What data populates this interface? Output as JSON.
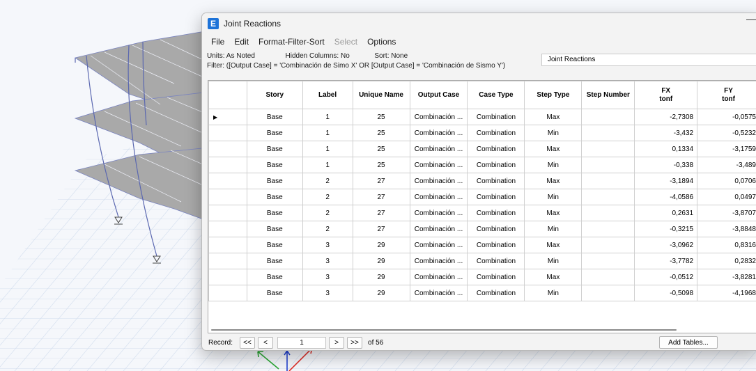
{
  "window": {
    "title": "Joint Reactions",
    "app_icon_letter": "E",
    "minimize_symbol": "—"
  },
  "menu": [
    "File",
    "Edit",
    "Format-Filter-Sort",
    "Select",
    "Options"
  ],
  "menu_disabled": [
    "Select"
  ],
  "info": {
    "units_label": "Units:",
    "units_value": "As Noted",
    "hidden_label": "Hidden Columns:",
    "hidden_value": "No",
    "sort_label": "Sort:",
    "sort_value": "None",
    "filter_label": "Filter:",
    "filter_value": "([Output Case] = 'Combinación de Simo X' OR [Output Case] = 'Combinación de Sismo Y')",
    "table_title": "Joint Reactions"
  },
  "columns": [
    {
      "name": "",
      "unit": ""
    },
    {
      "name": "Story",
      "unit": ""
    },
    {
      "name": "Label",
      "unit": ""
    },
    {
      "name": "Unique Name",
      "unit": ""
    },
    {
      "name": "Output Case",
      "unit": ""
    },
    {
      "name": "Case Type",
      "unit": ""
    },
    {
      "name": "Step Type",
      "unit": ""
    },
    {
      "name": "Step Number",
      "unit": ""
    },
    {
      "name": "FX",
      "unit": "tonf"
    },
    {
      "name": "FY",
      "unit": "tonf"
    }
  ],
  "rows": [
    [
      "Base",
      "1",
      "25",
      "Combinación ...",
      "Combination",
      "Max",
      "",
      "-2,7308",
      "-0,0575"
    ],
    [
      "Base",
      "1",
      "25",
      "Combinación ...",
      "Combination",
      "Min",
      "",
      "-3,432",
      "-0,5232"
    ],
    [
      "Base",
      "1",
      "25",
      "Combinación ...",
      "Combination",
      "Max",
      "",
      "0,1334",
      "-3,1759"
    ],
    [
      "Base",
      "1",
      "25",
      "Combinación ...",
      "Combination",
      "Min",
      "",
      "-0,338",
      "-3,489"
    ],
    [
      "Base",
      "2",
      "27",
      "Combinación ...",
      "Combination",
      "Max",
      "",
      "-3,1894",
      "0,0706"
    ],
    [
      "Base",
      "2",
      "27",
      "Combinación ...",
      "Combination",
      "Min",
      "",
      "-4,0586",
      "0,0497"
    ],
    [
      "Base",
      "2",
      "27",
      "Combinación ...",
      "Combination",
      "Max",
      "",
      "0,2631",
      "-3,8707"
    ],
    [
      "Base",
      "2",
      "27",
      "Combinación ...",
      "Combination",
      "Min",
      "",
      "-0,3215",
      "-3,8848"
    ],
    [
      "Base",
      "3",
      "29",
      "Combinación ...",
      "Combination",
      "Max",
      "",
      "-3,0962",
      "0,8316"
    ],
    [
      "Base",
      "3",
      "29",
      "Combinación ...",
      "Combination",
      "Min",
      "",
      "-3,7782",
      "0,2832"
    ],
    [
      "Base",
      "3",
      "29",
      "Combinación ...",
      "Combination",
      "Max",
      "",
      "-0,0512",
      "-3,8281"
    ],
    [
      "Base",
      "3",
      "29",
      "Combinación ...",
      "Combination",
      "Min",
      "",
      "-0,5098",
      "-4,1968"
    ]
  ],
  "selected_row_indicator": "▶",
  "record": {
    "label": "Record:",
    "first": "<<",
    "prev": "<",
    "current": "1",
    "next": ">",
    "last": ">>",
    "of_text": "of 56"
  },
  "add_tables_label": "Add Tables...",
  "colors": {
    "accent": "#1e73d8",
    "frame_line": "#5a67b0",
    "slab": "#a9a9a9",
    "grid_floor": "#c8d6ea",
    "axis_x": "#e0302a",
    "axis_y": "#2aa834",
    "axis_z": "#2040d0"
  }
}
